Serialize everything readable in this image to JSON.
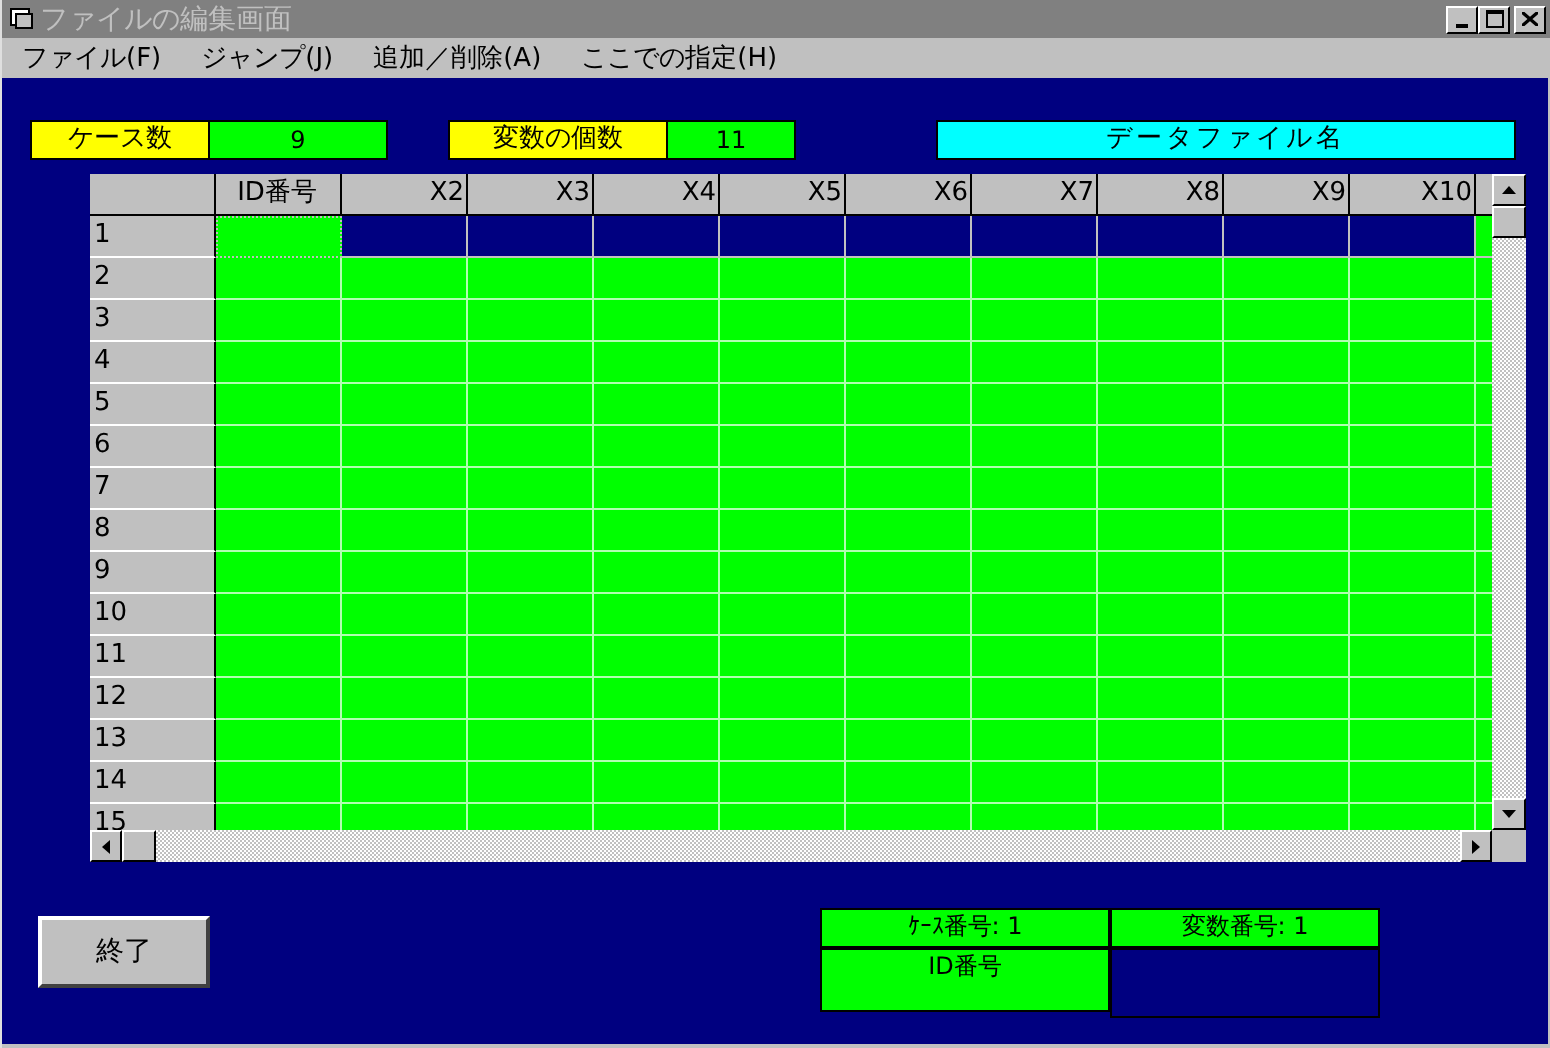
{
  "window": {
    "title": "ファイルの編集画面",
    "active": false
  },
  "menu": [
    "ファイル(F)",
    "ジャンプ(J)",
    "追加／削除(A)",
    "ここでの指定(H)"
  ],
  "case_count": {
    "label": "ケース数",
    "value": "9"
  },
  "variable_count": {
    "label": "変数の個数",
    "value": "11"
  },
  "data_file": {
    "label": "データファイル名"
  },
  "grid": {
    "columns": [
      "ID番号",
      "X2",
      "X3",
      "X4",
      "X5",
      "X6",
      "X7",
      "X8",
      "X9",
      "X10"
    ],
    "rows": [
      {
        "label": "1",
        "selected": true
      },
      {
        "label": "2",
        "selected": false
      },
      {
        "label": "3",
        "selected": false
      },
      {
        "label": "4",
        "selected": false
      },
      {
        "label": "5",
        "selected": false
      },
      {
        "label": "6",
        "selected": false
      },
      {
        "label": "7",
        "selected": false
      },
      {
        "label": "8",
        "selected": false
      },
      {
        "label": "9",
        "selected": false
      },
      {
        "label": "10",
        "selected": false
      },
      {
        "label": "11",
        "selected": false
      },
      {
        "label": "12",
        "selected": false
      },
      {
        "label": "13",
        "selected": false
      },
      {
        "label": "14",
        "selected": false
      },
      {
        "label": "15",
        "selected": false
      }
    ]
  },
  "exit_button": "終了",
  "status": {
    "case_number": "ｹｰｽ番号: 1",
    "variable_number": "変数番号: 1",
    "variable_name": "ID番号"
  }
}
